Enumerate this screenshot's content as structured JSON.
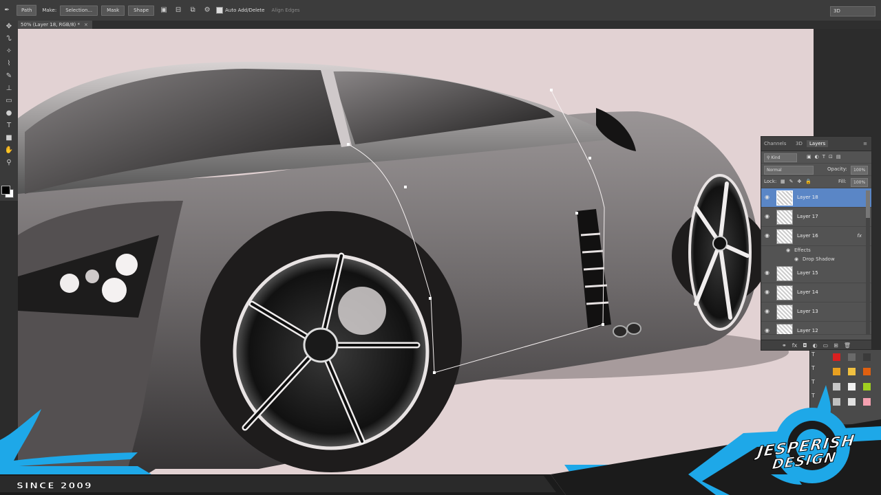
{
  "options_bar": {
    "tool_mode": "Path",
    "make_label": "Make:",
    "selection_btn": "Selection...",
    "mask_btn": "Mask",
    "shape_btn": "Shape",
    "auto_add_delete": "Auto Add/Delete",
    "align_edges": "Align Edges",
    "workspace": "3D"
  },
  "document": {
    "tab_title": "50% (Layer 18, RGB/8) *",
    "close": "×"
  },
  "layers_panel": {
    "tabs": [
      "Channels",
      "3D",
      "Layers"
    ],
    "kind_filter": "Kind",
    "blend_mode": "Normal",
    "opacity_label": "Opacity:",
    "opacity_value": "100%",
    "lock_label": "Lock:",
    "fill_label": "Fill:",
    "fill_value": "100%",
    "layers": [
      {
        "name": "Layer 18",
        "selected": true
      },
      {
        "name": "Layer 17",
        "selected": false
      },
      {
        "name": "Layer 16",
        "selected": false,
        "fx": "fx"
      },
      {
        "name": "Layer 15",
        "selected": false
      },
      {
        "name": "Layer 14",
        "selected": false
      },
      {
        "name": "Layer 13",
        "selected": false
      },
      {
        "name": "Layer 12",
        "selected": false
      }
    ],
    "effects_label": "Effects",
    "drop_shadow_label": "Drop Shadow"
  },
  "swatch_colors": [
    "#d82020",
    "#6a6a6a",
    "#3a3a3a",
    "#e8a020",
    "#f0c040",
    "#e06010",
    "#c8c8c8",
    "#f0f0f0",
    "#a0d020",
    "#c0c0c0",
    "#e0e0e0",
    "#f5a0b0"
  ],
  "branding": {
    "since": "SINCE 2009",
    "logo_line1": "JESPERISH",
    "logo_line2": "DESIGN",
    "accent_color": "#1ea8e8"
  }
}
